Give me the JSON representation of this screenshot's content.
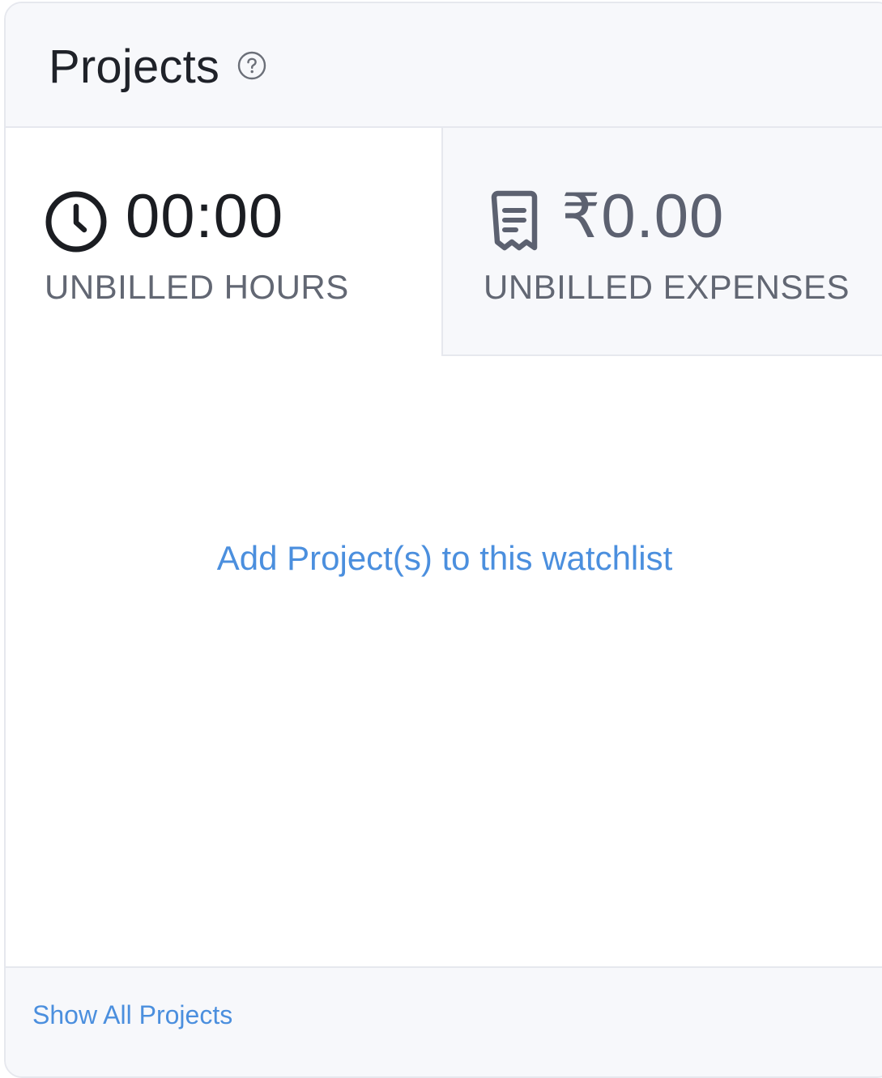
{
  "card": {
    "title": "Projects",
    "help_icon": "question-circle-icon"
  },
  "stats": {
    "hours": {
      "icon": "clock-icon",
      "value": "00:00",
      "label": "UNBILLED HOURS"
    },
    "expenses": {
      "icon": "receipt-icon",
      "value": "₹0.00",
      "label": "UNBILLED EXPENSES"
    }
  },
  "empty_state": {
    "link_text": "Add Project(s) to this watchlist"
  },
  "footer": {
    "link_text": "Show All Projects"
  },
  "colors": {
    "link": "#4b8fde",
    "header_bg": "#f7f8fb",
    "border": "#e6e8ee",
    "title": "#1f2229",
    "label": "#626773"
  }
}
